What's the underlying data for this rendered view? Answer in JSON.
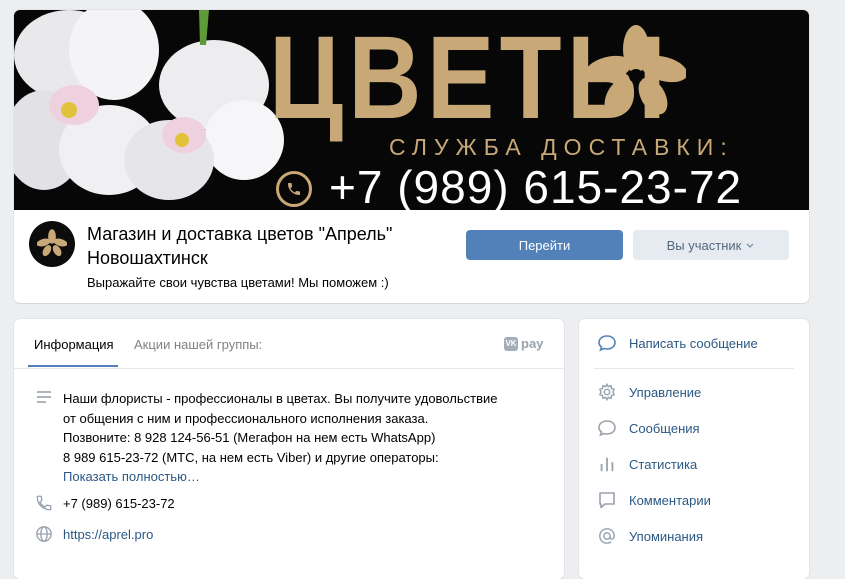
{
  "cover": {
    "title": "ЦВЕТЫ",
    "subtitle": "СЛУЖБА ДОСТАВКИ:",
    "phone": "+7 (989) 615-23-72"
  },
  "group": {
    "name": "Магазин и доставка цветов \"Апрель\" Новошахтинск",
    "status": "Выражайте свои чувства цветами! Мы поможем :)"
  },
  "actions": {
    "go_label": "Перейти",
    "member_label": "Вы участник"
  },
  "tabs": [
    {
      "label": "Информация"
    },
    {
      "label": "Акции нашей группы:"
    }
  ],
  "vkpay": {
    "label": "pay",
    "badge": "VK"
  },
  "info": {
    "description_lines": [
      "Наши флористы - профессионалы в цветах. Вы получите удовольствие",
      "от общения с ним и профессионального исполнения заказа.",
      "Позвоните: 8 928 124-56-51 (Мегафон на нем есть WhatsApp)",
      "8 989 615-23-72 (МТС, на нем есть Viber) и другие операторы:"
    ],
    "show_more": "Показать полностью…",
    "phone": "+7 (989) 615-23-72",
    "site": "https://aprel.pro"
  },
  "side_menu": {
    "write_message": "Написать сообщение",
    "items": [
      {
        "label": "Управление",
        "icon": "gear-icon"
      },
      {
        "label": "Сообщения",
        "icon": "chat-icon"
      },
      {
        "label": "Статистика",
        "icon": "stats-icon"
      },
      {
        "label": "Комментарии",
        "icon": "comment-icon"
      },
      {
        "label": "Упоминания",
        "icon": "at-icon"
      }
    ]
  },
  "colors": {
    "accent": "#5181b8",
    "link": "#2a5885",
    "gold": "#c8a877",
    "page_bg": "#edeef0"
  }
}
